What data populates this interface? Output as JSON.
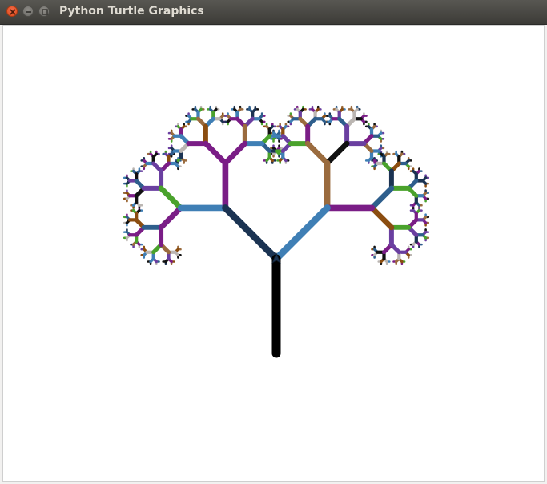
{
  "window": {
    "title": "Python Turtle Graphics"
  },
  "colors": {
    "titlebar": "#3c3b37",
    "close_button": "#df4a16",
    "canvas_bg": "#ffffff",
    "trunk": "#000000",
    "palette": [
      "#1b3352",
      "#2e5e8c",
      "#7a1d86",
      "#8b4d10",
      "#4aa22c",
      "#bbb6b2",
      "#111111",
      "#9a6b3e",
      "#6a3fa0",
      "#3f7fb5"
    ]
  },
  "icons": {
    "close": "close-icon",
    "minimize": "minimize-icon",
    "maximize": "maximize-icon",
    "turtle": "turtle-cursor-icon"
  }
}
